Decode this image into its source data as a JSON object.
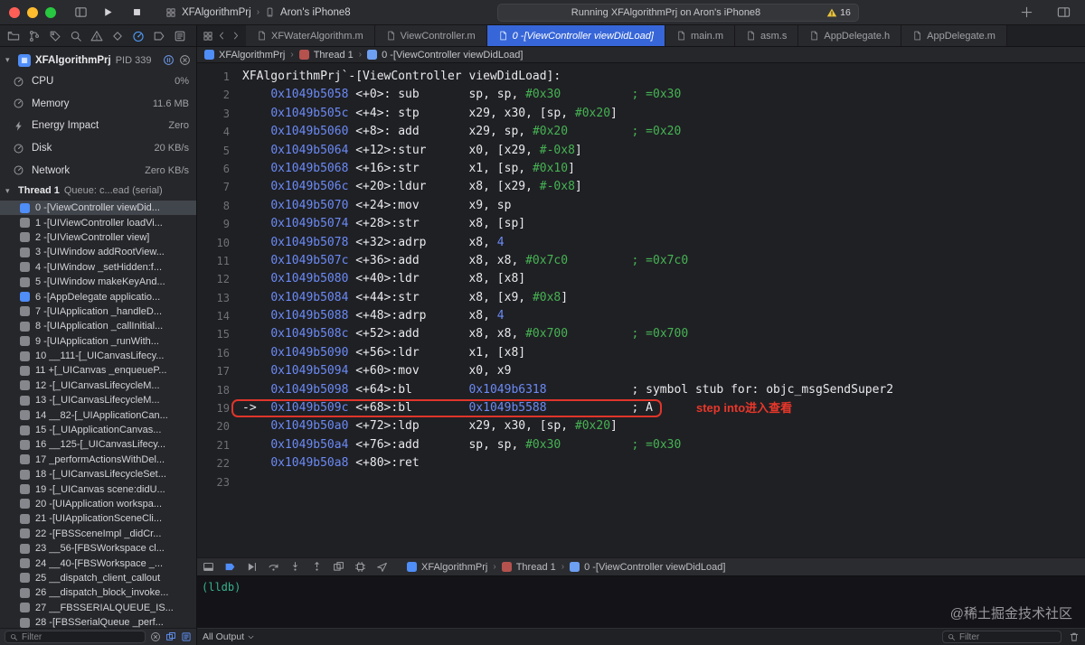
{
  "titlebar": {
    "scheme": {
      "project": "XFAlgorithmPrj",
      "device": "Aron's iPhone8"
    },
    "status": {
      "text": "Running XFAlgorithmPrj on Aron's iPhone8",
      "warnings": "16"
    }
  },
  "navigator": {
    "icons": [
      {
        "name": "project"
      },
      {
        "name": "source-control"
      },
      {
        "name": "symbols"
      },
      {
        "name": "search"
      },
      {
        "name": "issues"
      },
      {
        "name": "tests"
      },
      {
        "name": "debug",
        "active": true
      },
      {
        "name": "breakpoints"
      },
      {
        "name": "reports"
      }
    ]
  },
  "tabs": {
    "items": [
      {
        "label": "XFWaterAlgorithm.m",
        "selected": false
      },
      {
        "label": "ViewController.m",
        "selected": false
      },
      {
        "label": "0 -[ViewController viewDidLoad]",
        "selected": true
      },
      {
        "label": "main.m",
        "selected": false
      },
      {
        "label": "asm.s",
        "selected": false
      },
      {
        "label": "AppDelegate.h",
        "selected": false
      },
      {
        "label": "AppDelegate.m",
        "selected": false
      }
    ]
  },
  "sidebar": {
    "process": {
      "name": "XFAlgorithmPrj",
      "pid": "PID 339"
    },
    "gauges": [
      {
        "label": "CPU",
        "value": "0%",
        "icon": "gauge"
      },
      {
        "label": "Memory",
        "value": "11.6 MB",
        "icon": "gauge"
      },
      {
        "label": "Energy Impact",
        "value": "Zero",
        "icon": "lightning"
      },
      {
        "label": "Disk",
        "value": "20 KB/s",
        "icon": "gauge"
      },
      {
        "label": "Network",
        "value": "Zero KB/s",
        "icon": "gauge"
      }
    ],
    "thread": {
      "name": "Thread 1",
      "detail": "Queue: c...ead (serial)"
    },
    "frames": [
      {
        "label": "0 -[ViewController viewDid...",
        "user": true,
        "selected": true
      },
      {
        "label": "1 -[UIViewController loadVi...",
        "user": false
      },
      {
        "label": "2 -[UIViewController view]",
        "user": false
      },
      {
        "label": "3 -[UIWindow addRootView...",
        "user": false
      },
      {
        "label": "4 -[UIWindow _setHidden:f...",
        "user": false
      },
      {
        "label": "5 -[UIWindow makeKeyAnd...",
        "user": false
      },
      {
        "label": "6 -[AppDelegate applicatio...",
        "user": true
      },
      {
        "label": "7 -[UIApplication _handleD...",
        "user": false
      },
      {
        "label": "8 -[UIApplication _callInitial...",
        "user": false
      },
      {
        "label": "9 -[UIApplication _runWith...",
        "user": false
      },
      {
        "label": "10 __111-[_UICanvasLifecy...",
        "user": false
      },
      {
        "label": "11 +[_UICanvas _enqueueP...",
        "user": false
      },
      {
        "label": "12 -[_UICanvasLifecycleM...",
        "user": false
      },
      {
        "label": "13 -[_UICanvasLifecycleM...",
        "user": false
      },
      {
        "label": "14 __82-[_UIApplicationCan...",
        "user": false
      },
      {
        "label": "15 -[_UIApplicationCanvas...",
        "user": false
      },
      {
        "label": "16 __125-[_UICanvasLifecy...",
        "user": false
      },
      {
        "label": "17 _performActionsWithDel...",
        "user": false
      },
      {
        "label": "18 -[_UICanvasLifecycleSet...",
        "user": false
      },
      {
        "label": "19 -[_UICanvas scene:didU...",
        "user": false
      },
      {
        "label": "20 -[UIApplication workspa...",
        "user": false
      },
      {
        "label": "21 -[UIApplicationSceneCli...",
        "user": false
      },
      {
        "label": "22 -[FBSSceneImpl _didCr...",
        "user": false
      },
      {
        "label": "23 __56-[FBSWorkspace cl...",
        "user": false
      },
      {
        "label": "24 __40-[FBSWorkspace _...",
        "user": false
      },
      {
        "label": "25 __dispatch_client_callout",
        "user": false
      },
      {
        "label": "26 __dispatch_block_invoke...",
        "user": false
      },
      {
        "label": "27 __FBSSERIALQUEUE_IS...",
        "user": false
      },
      {
        "label": "28 -[FBSSerialQueue _perf...",
        "user": false
      }
    ],
    "filter_placeholder": "Filter"
  },
  "breadcrumb": {
    "items": [
      {
        "label": "XFAlgorithmPrj",
        "icon": "project"
      },
      {
        "label": "Thread 1",
        "icon": "thread"
      },
      {
        "label": "0 -[ViewController viewDidLoad]",
        "icon": "frame"
      }
    ]
  },
  "editor": {
    "annotation": "step into进入查看",
    "lines": [
      {
        "n": 1,
        "type": "label",
        "text": "XFAlgorithmPrj`-[ViewController viewDidLoad]:"
      },
      {
        "n": 2,
        "type": "asm",
        "addr": "0x1049b5058",
        "off": "<+0>:",
        "mnem": "sub",
        "ops": "sp, sp, #0x30",
        "cmt": "; =0x30",
        "green": true
      },
      {
        "n": 3,
        "type": "asm",
        "addr": "0x1049b505c",
        "off": "<+4>:",
        "mnem": "stp",
        "ops": "x29, x30, [sp, #0x20]"
      },
      {
        "n": 4,
        "type": "asm",
        "addr": "0x1049b5060",
        "off": "<+8>:",
        "mnem": "add",
        "ops": "x29, sp, #0x20",
        "cmt": "; =0x20",
        "green": true
      },
      {
        "n": 5,
        "type": "asm",
        "addr": "0x1049b5064",
        "off": "<+12>:",
        "mnem": "stur",
        "ops": "x0, [x29, #-0x8]"
      },
      {
        "n": 6,
        "type": "asm",
        "addr": "0x1049b5068",
        "off": "<+16>:",
        "mnem": "str",
        "ops": "x1, [sp, #0x10]"
      },
      {
        "n": 7,
        "type": "asm",
        "addr": "0x1049b506c",
        "off": "<+20>:",
        "mnem": "ldur",
        "ops": "x8, [x29, #-0x8]"
      },
      {
        "n": 8,
        "type": "asm",
        "addr": "0x1049b5070",
        "off": "<+24>:",
        "mnem": "mov",
        "ops": "x9, sp"
      },
      {
        "n": 9,
        "type": "asm",
        "addr": "0x1049b5074",
        "off": "<+28>:",
        "mnem": "str",
        "ops": "x8, [sp]"
      },
      {
        "n": 10,
        "type": "asm",
        "addr": "0x1049b5078",
        "off": "<+32>:",
        "mnem": "adrp",
        "ops": "x8, 4"
      },
      {
        "n": 11,
        "type": "asm",
        "addr": "0x1049b507c",
        "off": "<+36>:",
        "mnem": "add",
        "ops": "x8, x8, #0x7c0",
        "cmt": "; =0x7c0",
        "green": true
      },
      {
        "n": 12,
        "type": "asm",
        "addr": "0x1049b5080",
        "off": "<+40>:",
        "mnem": "ldr",
        "ops": "x8, [x8]"
      },
      {
        "n": 13,
        "type": "asm",
        "addr": "0x1049b5084",
        "off": "<+44>:",
        "mnem": "str",
        "ops": "x8, [x9, #0x8]"
      },
      {
        "n": 14,
        "type": "asm",
        "addr": "0x1049b5088",
        "off": "<+48>:",
        "mnem": "adrp",
        "ops": "x8, 4"
      },
      {
        "n": 15,
        "type": "asm",
        "addr": "0x1049b508c",
        "off": "<+52>:",
        "mnem": "add",
        "ops": "x8, x8, #0x700",
        "cmt": "; =0x700",
        "green": true
      },
      {
        "n": 16,
        "type": "asm",
        "addr": "0x1049b5090",
        "off": "<+56>:",
        "mnem": "ldr",
        "ops": "x1, [x8]"
      },
      {
        "n": 17,
        "type": "asm",
        "addr": "0x1049b5094",
        "off": "<+60>:",
        "mnem": "mov",
        "ops": "x0, x9"
      },
      {
        "n": 18,
        "type": "asm",
        "addr": "0x1049b5098",
        "off": "<+64>:",
        "mnem": "bl",
        "ops": "0x1049b6318",
        "cmt": "; symbol stub for: objc_msgSendSuper2"
      },
      {
        "n": 19,
        "type": "asm",
        "arrow": true,
        "boxed": true,
        "addr": "0x1049b509c",
        "off": "<+68>:",
        "mnem": "bl",
        "ops": "0x1049b5588",
        "cmt": "; A"
      },
      {
        "n": 20,
        "type": "asm",
        "addr": "0x1049b50a0",
        "off": "<+72>:",
        "mnem": "ldp",
        "ops": "x29, x30, [sp, #0x20]"
      },
      {
        "n": 21,
        "type": "asm",
        "addr": "0x1049b50a4",
        "off": "<+76>:",
        "mnem": "add",
        "ops": "sp, sp, #0x30",
        "cmt": "; =0x30",
        "green": true
      },
      {
        "n": 22,
        "type": "asm",
        "addr": "0x1049b50a8",
        "off": "<+80>:",
        "mnem": "ret",
        "ops": ""
      },
      {
        "n": 23,
        "type": "empty"
      }
    ]
  },
  "debugbar": {
    "icons": [
      "hide-console",
      "bp-arrow",
      "continue",
      "step-over",
      "step-into",
      "step-out",
      "view-ui",
      "memory",
      "location"
    ]
  },
  "console": {
    "prompt": "(lldb)",
    "output_label": "All Output",
    "filter_placeholder": "Filter"
  },
  "watermark": "@稀土掘金技术社区"
}
